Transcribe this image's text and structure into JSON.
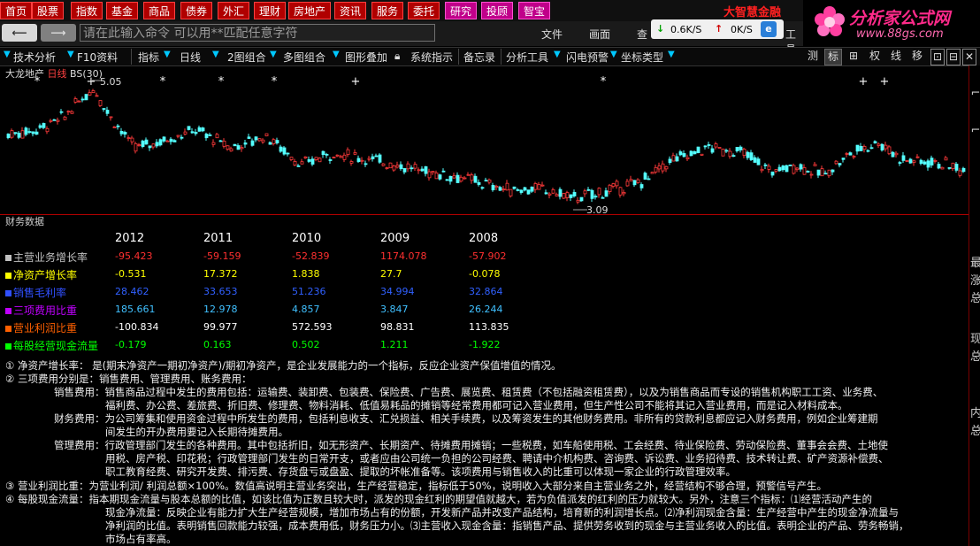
{
  "menu": {
    "items": [
      "首页",
      "股票",
      "指数",
      "基金",
      "商品",
      "债券",
      "外汇",
      "理财",
      "房地产",
      "资讯",
      "服务",
      "委托",
      "研究",
      "投顾",
      "智宝"
    ],
    "brand": "大智慧金融"
  },
  "logo": {
    "title": "分析家公式网",
    "url": "www.88gs.com"
  },
  "command": {
    "placeholder": "请在此输入命令  可以用**匹配任意字符",
    "menus": [
      "文件",
      "画面",
      "查"
    ],
    "tools_label": "工具",
    "speed_down": "0.6K/S",
    "speed_up": "0K/S"
  },
  "toolbar": {
    "items": [
      "技术分析",
      "F10资料",
      "指标",
      "日线",
      "2图组合",
      "多图组合",
      "图形叠加",
      "系统指示",
      "备忘录",
      "分析工具",
      "闪电预警",
      "坐标类型"
    ],
    "right_buttons": [
      "测",
      "标",
      "⊞",
      "权",
      "线",
      "移"
    ]
  },
  "chart": {
    "stock_name": "大龙地产",
    "period": "日线",
    "indicator": "BS(30)",
    "high_label": "5.05",
    "low_label": "3.09"
  },
  "chart_data": {
    "type": "candlestick",
    "title": "大龙地产 日线",
    "annotations": [
      "5.05",
      "3.09"
    ],
    "y_range": [
      3.0,
      5.2
    ]
  },
  "finance": {
    "section_title": "财务数据",
    "years": [
      "2012",
      "2011",
      "2010",
      "2009",
      "2008"
    ],
    "rows": [
      {
        "label": "主营业务增长率",
        "color": "#c0c0c0",
        "value_color": "#ff3030",
        "values": [
          "-95.423",
          "-59.159",
          "-52.839",
          "1174.078",
          "-57.902"
        ]
      },
      {
        "label": "净资产增长率",
        "color": "#ffff00",
        "value_color": "#ffff00",
        "values": [
          "-0.531",
          "17.372",
          "1.838",
          "27.7",
          "-0.078"
        ]
      },
      {
        "label": "销售毛利率",
        "color": "#3050ff",
        "value_color": "#3060ff",
        "values": [
          "28.462",
          "33.653",
          "51.236",
          "34.994",
          "32.864"
        ]
      },
      {
        "label": "三项费用比重",
        "color": "#c000ff",
        "value_color": "#40c0ff",
        "values": [
          "185.661",
          "12.978",
          "4.857",
          "3.847",
          "26.244"
        ]
      },
      {
        "label": "营业利润比重",
        "color": "#ff6000",
        "value_color": "#ffffff",
        "values": [
          "-100.834",
          "99.977",
          "572.593",
          "98.831",
          "113.835"
        ]
      },
      {
        "label": "每股经营现金流量",
        "color": "#00ff00",
        "value_color": "#00ff00",
        "values": [
          "-0.179",
          "0.163",
          "0.502",
          "1.211",
          "-1.922"
        ]
      }
    ]
  },
  "notes": {
    "n1": "①  净资产增长率：  是(期末净资产一期初净资产)/期初净资产，是企业发展能力的一个指标，反应企业资产保值增值的情况。",
    "n2": "②  三项费用分别是：销售费用、管理费用、账务费用：",
    "n2a": "销售费用：销售商品过程中发生的费用包括：运输费、装卸费、包装费、保险费、广告费、展览费、租赁费（不包括融资租赁费），以及为销售商品而专设的销售机构职工工资、业务费、",
    "n2b": "福利费、办公费、差旅费、折旧费、修理费、物料消耗、低值易耗品的摊销等经常费用都可记入营业费用，但生产性公司不能将其记入营业费用，而是记入材料成本。",
    "n2c": "财务费用：为公司筹集和使用资金过程中所发生的费用，包括利息收支、汇兑损益、相关手续费，以及筹资发生的其他财务费用。非所有的贷款利息都应记入财务费用，例如企业筹建期",
    "n2d": "间发生的开办费用要记入长期待摊费用。",
    "n2e": "管理费用：行政管理部门发生的各种费用。其中包括折旧，如无形资产、长期资产、待摊费用摊销；一些税费，如车船使用税、工会经费、待业保险费、劳动保险费、董事会会费、土地使",
    "n2f": "用税、房产税、印花税；行政管理部门发生的日常开支，或者应由公司统一负担的公司经费、聘请中介机构费、咨询费、诉讼费、业务招待费、技术转让费、矿产资源补偿费、",
    "n2g": "职工教育经费、研究开发费、排污费、存货盘亏或盘盈、提取的坏帐准备等。该项费用与销售收入的比重可以体现一家企业的行政管理效率。",
    "n3": "③  营业利润比重：为营业利润/ 利润总额×100%。数值高说明主营业务突出，生产经营稳定，指标低于50%，说明收入大部分来自主营业务之外，经营结构不够合理，预警信号产生。",
    "n4": "④  每股现金流量：指本期现金流量与股本总额的比值，如该比值为正数且较大时，派发的现金红利的期望值就越大，若为负值派发的红利的压力就较大。另外，注意三个指标：⑴经营活动产生的",
    "n4a": "现金净流量：反映企业有能力扩大生产经营规模，增加市场占有的份额，开发新产品并改变产品结构，培育新的利润增长点。⑵净利润现金含量：生产经营中产生的现金净流量与",
    "n4b": "净利润的比值。表明销售回款能力较强，成本费用低，财务压力小。⑶主营收入现金含量：指销售产品、提供劳务收到的现金与主营业务收入的比值。表明企业的产品、劳务畅销，",
    "n4c": "市场占有率高。"
  },
  "side_text": [
    "最",
    "涨",
    "总",
    "现",
    "总",
    "内",
    "总"
  ]
}
